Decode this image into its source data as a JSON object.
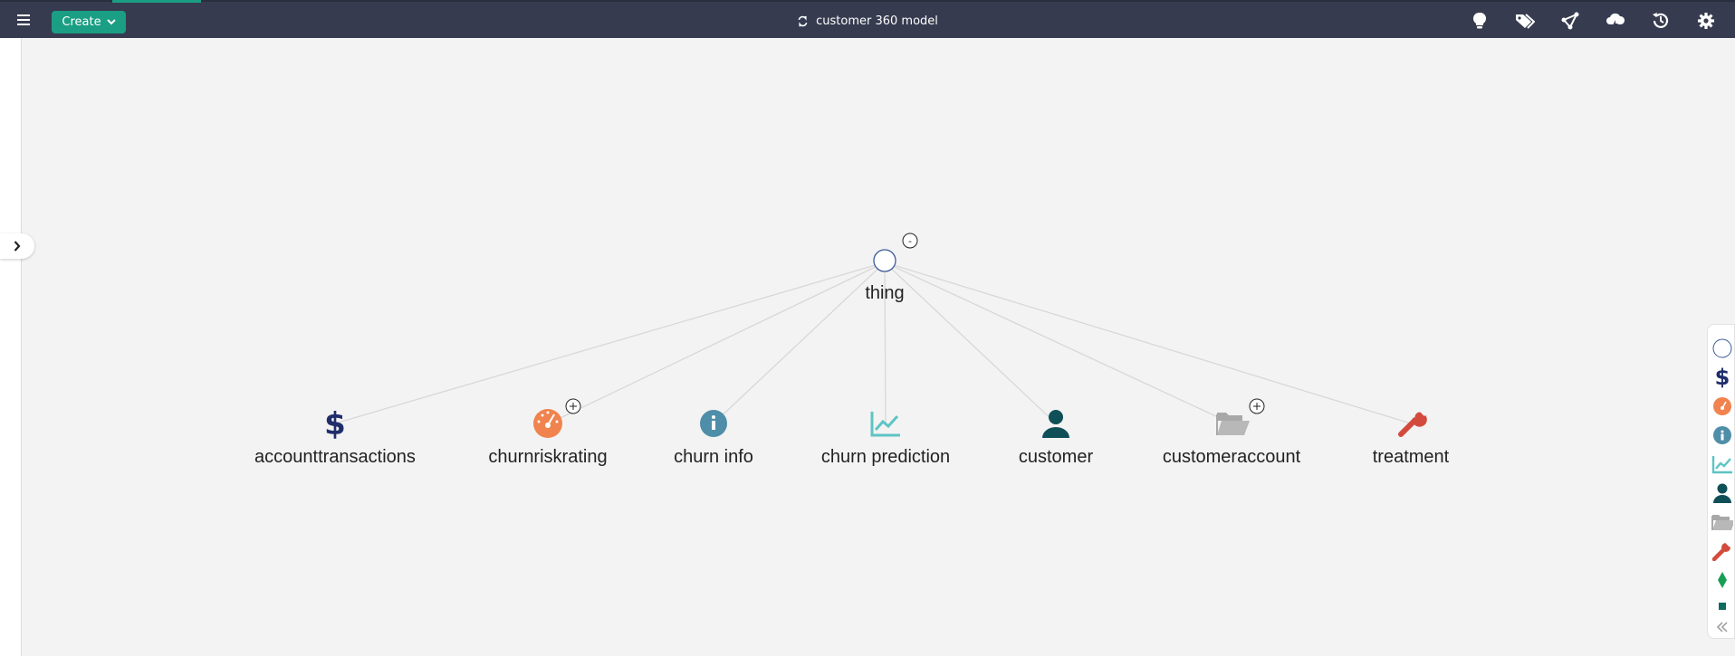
{
  "header": {
    "create_label": "Create",
    "model_title": "customer 360 model"
  },
  "graph": {
    "root": {
      "label": "thing",
      "collapse_symbol": "-"
    },
    "children": [
      {
        "label": "accounttransactions",
        "icon": "dollar-icon",
        "color": "#1f2d6b",
        "expandable": false
      },
      {
        "label": "churnriskrating",
        "icon": "gauge-icon",
        "color": "#f0834e",
        "expandable": true
      },
      {
        "label": "churn info",
        "icon": "info-icon",
        "color": "#4f8ea8",
        "expandable": false
      },
      {
        "label": "churn prediction",
        "icon": "line-chart-icon",
        "color": "#5fc4c4",
        "expandable": false
      },
      {
        "label": "customer",
        "icon": "user-icon",
        "color": "#0f4f57",
        "expandable": false
      },
      {
        "label": "customeraccount",
        "icon": "folder-open-icon",
        "color": "#a8a8a8",
        "expandable": true
      },
      {
        "label": "treatment",
        "icon": "wrench-icon",
        "color": "#d34b3c",
        "expandable": false
      }
    ]
  },
  "colors": {
    "topbar": "#363b4f",
    "accent": "#1a9e84",
    "edge": "#d8d8d8"
  }
}
